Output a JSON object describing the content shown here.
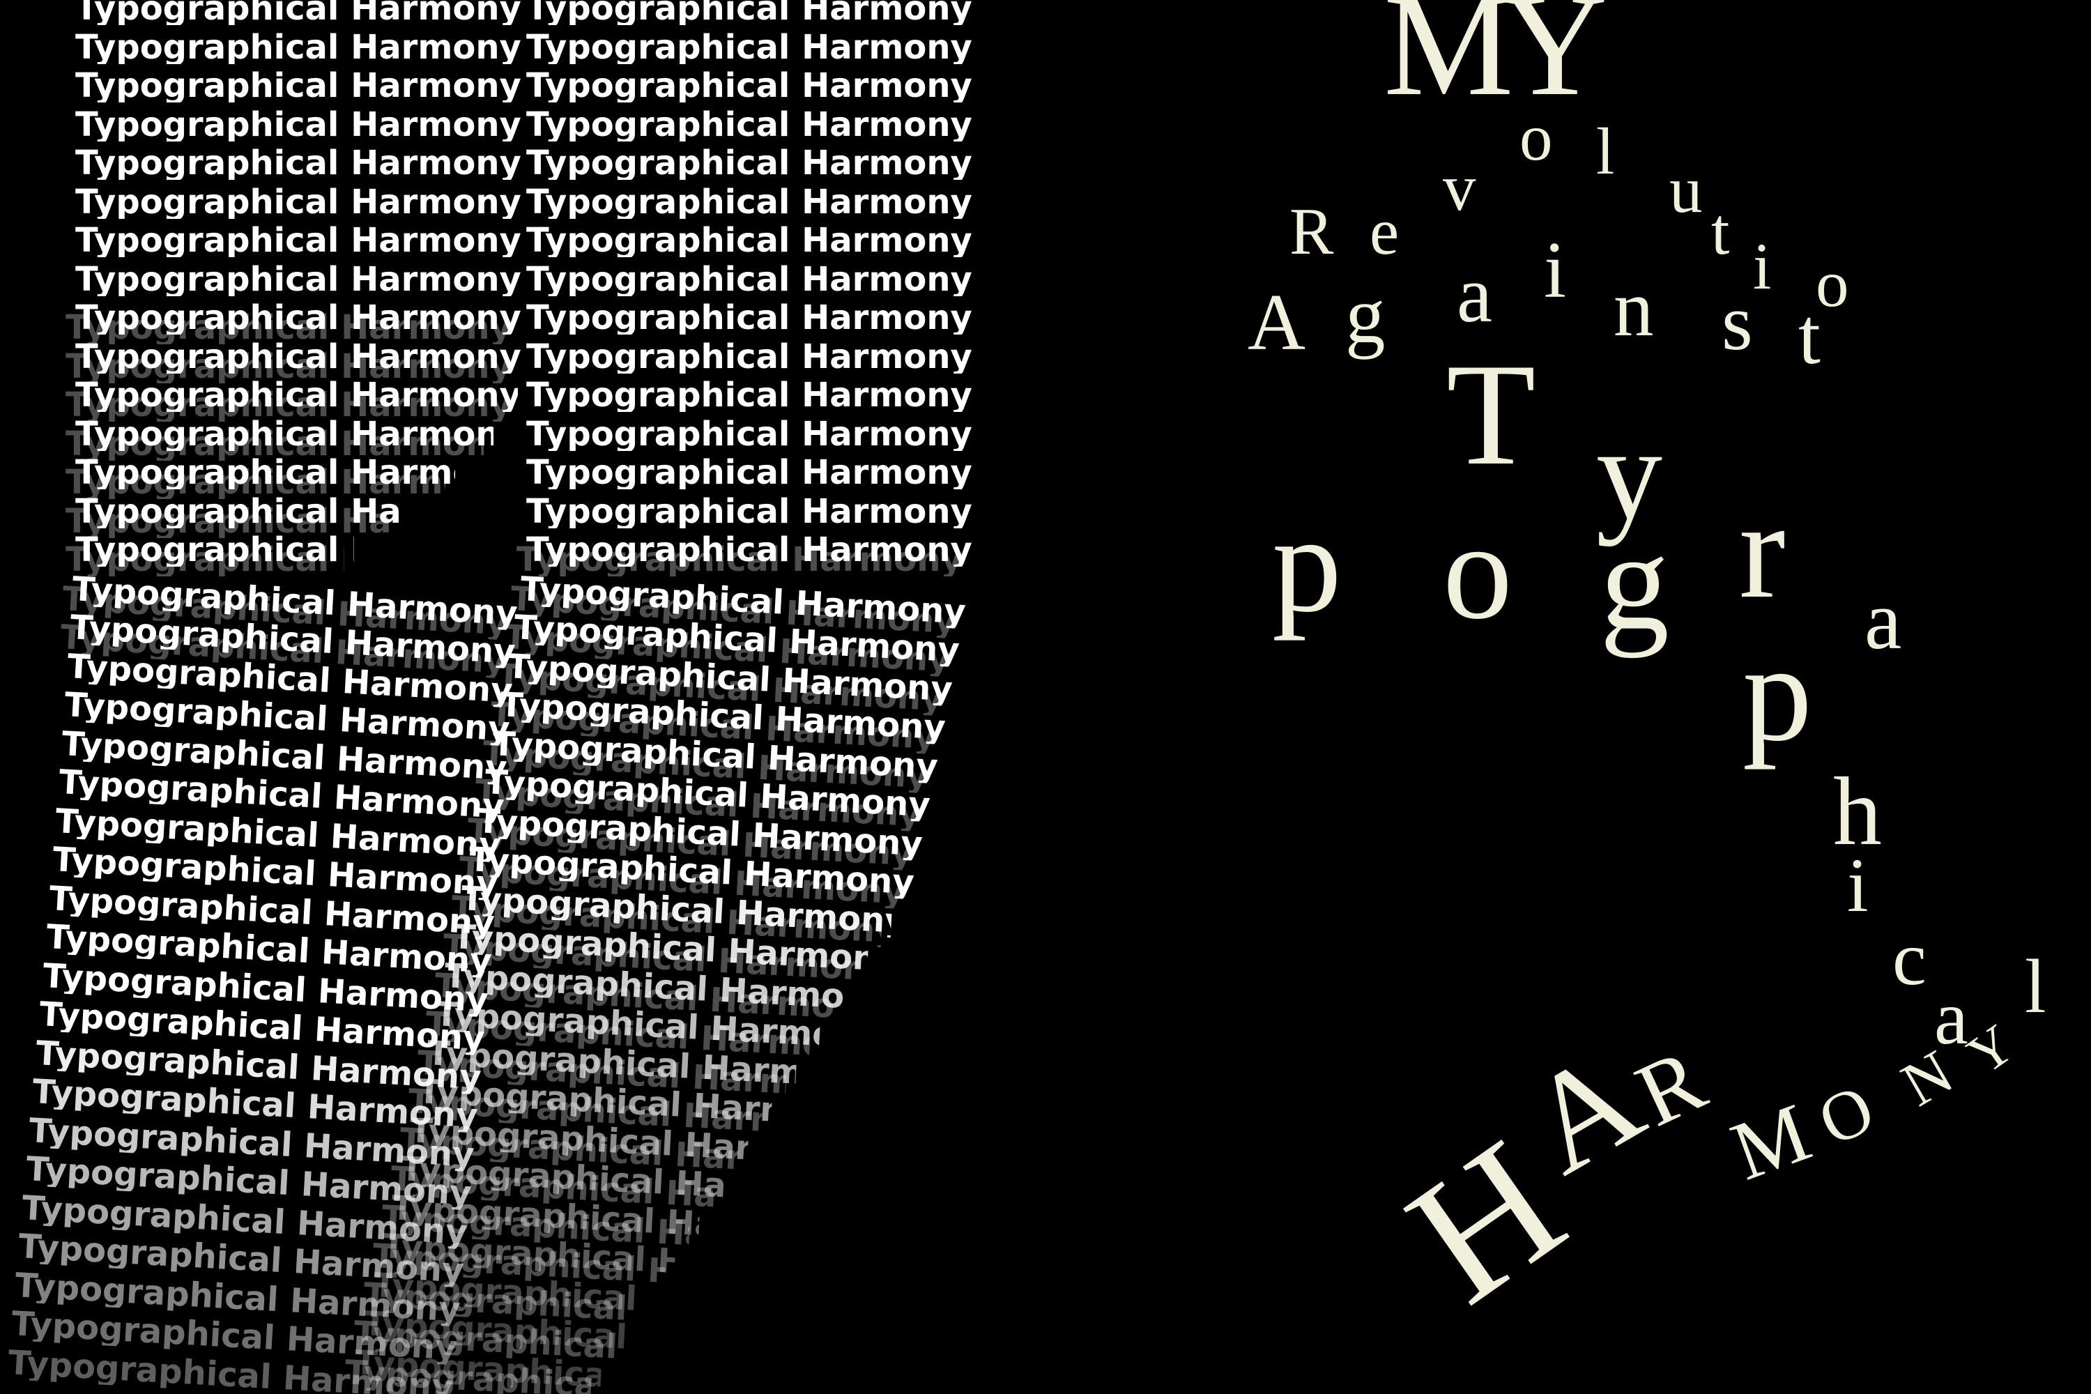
{
  "poster": {
    "background": "#000000",
    "text_color": "#ffffff",
    "accent_color": "#f1f0dc",
    "repeated_phrase": "Typographical Harmony",
    "title_words": [
      "MY",
      "Revolution",
      "Against",
      "Typographical",
      "HARMONY"
    ]
  }
}
